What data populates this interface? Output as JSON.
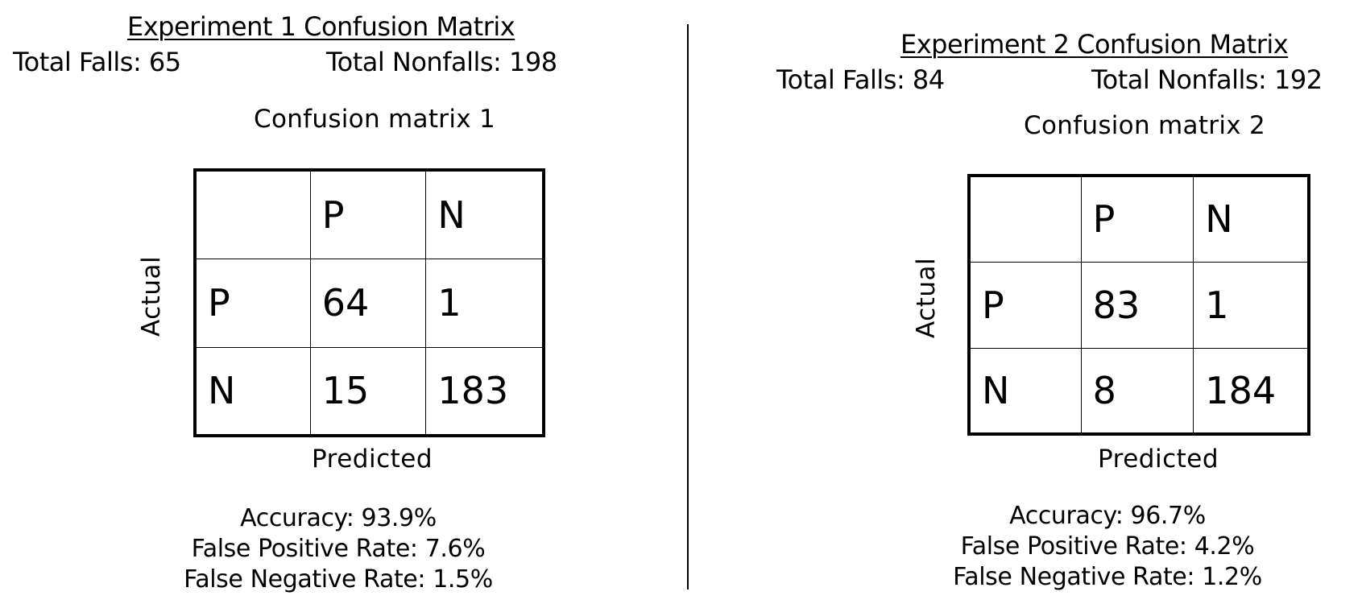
{
  "experiments": [
    {
      "title": "Experiment 1 Confusion Matrix",
      "total_falls": "Total Falls: 65",
      "total_nonfalls": "Total Nonfalls: 198",
      "matrix_title": "Confusion matrix 1",
      "axis_actual": "Actual",
      "axis_predicted": "Predicted",
      "header": [
        "",
        "P",
        "N"
      ],
      "rows": [
        [
          "P",
          "64",
          "1"
        ],
        [
          "N",
          "15",
          "183"
        ]
      ],
      "accuracy": "Accuracy: 93.9%",
      "false_positive_rate": "False Positive Rate: 7.6%",
      "false_negative_rate": "False Negative Rate: 1.5%"
    },
    {
      "title": "Experiment 2 Confusion Matrix",
      "total_falls": "Total Falls: 84",
      "total_nonfalls": "Total Nonfalls: 192",
      "matrix_title": "Confusion matrix 2",
      "axis_actual": "Actual",
      "axis_predicted": "Predicted",
      "header": [
        "",
        "P",
        "N"
      ],
      "rows": [
        [
          "P",
          "83",
          "1"
        ],
        [
          "N",
          "8",
          "184"
        ]
      ],
      "accuracy": "Accuracy: 96.7%",
      "false_positive_rate": "False Positive Rate: 4.2%",
      "false_negative_rate": "False Negative Rate: 1.2%"
    }
  ]
}
